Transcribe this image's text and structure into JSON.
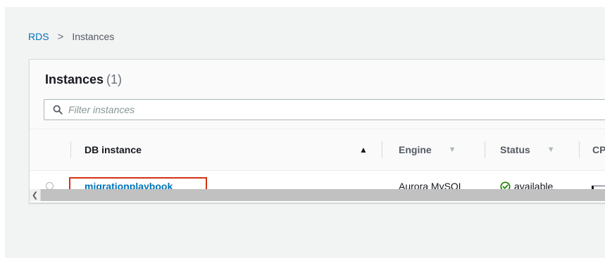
{
  "breadcrumb": {
    "items": [
      {
        "label": "RDS"
      },
      {
        "label": "Instances"
      }
    ],
    "separator": ">"
  },
  "panel": {
    "title": "Instances",
    "count": "(1)"
  },
  "search": {
    "placeholder": "Filter instances",
    "value": ""
  },
  "table": {
    "columns": [
      {
        "label": "DB instance",
        "sort": "ascending"
      },
      {
        "label": "Engine",
        "sort": "none"
      },
      {
        "label": "Status",
        "sort": "none"
      },
      {
        "label": "CP"
      }
    ],
    "rows": [
      {
        "db_instance": "migrationplaybook",
        "engine": "Aurora MySQL",
        "status": "available"
      }
    ]
  },
  "colors": {
    "link": "#0073bb",
    "highlight_border": "#d13212",
    "status_ok": "#1d8102"
  }
}
